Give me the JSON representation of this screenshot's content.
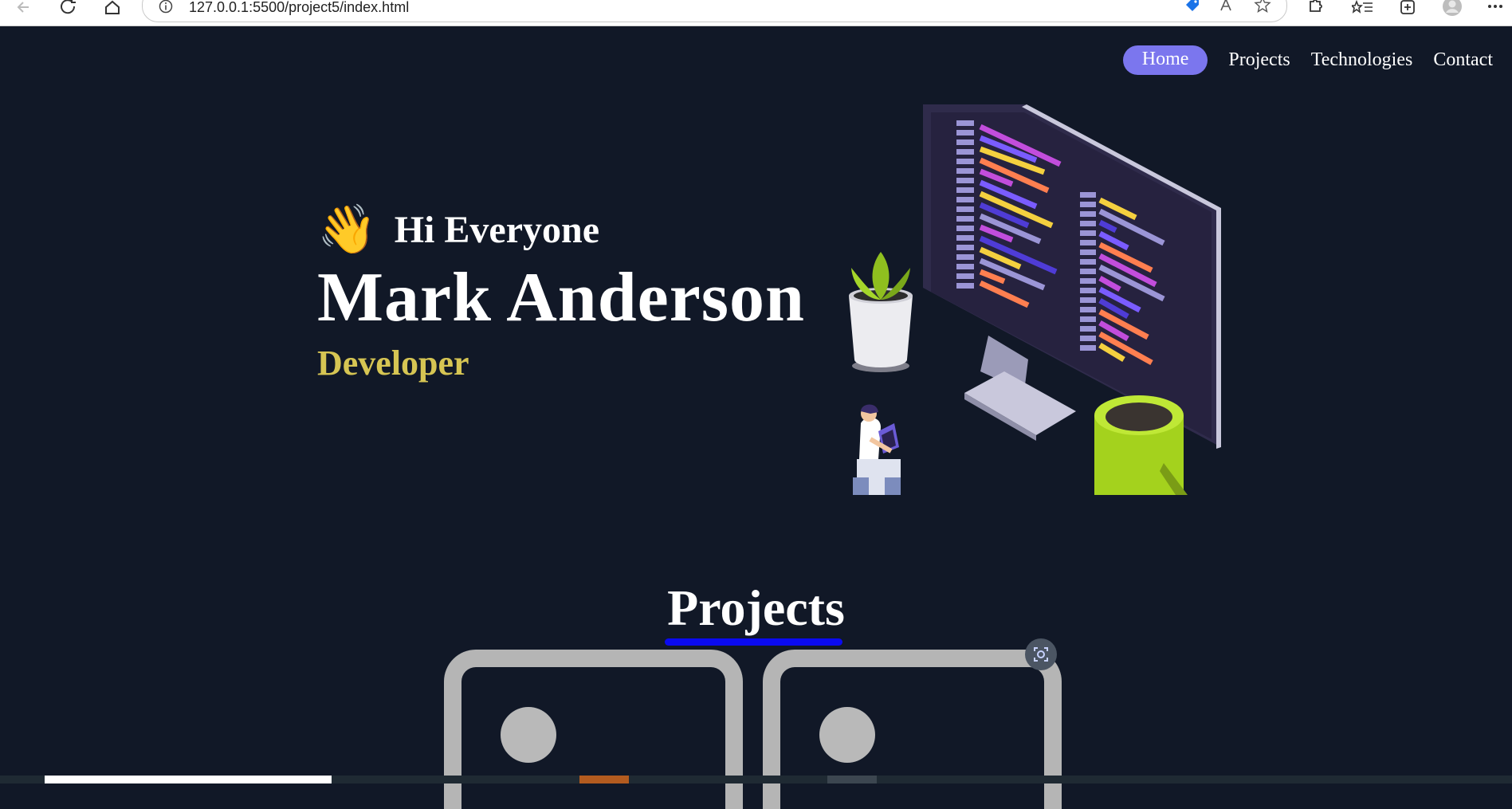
{
  "browser": {
    "url": "127.0.0.1:5500/project5/index.html",
    "icons": [
      "back-icon",
      "refresh-icon",
      "home-icon",
      "info-icon",
      "tag-icon",
      "read-aloud-icon",
      "favorite-add-icon",
      "extensions-icon",
      "favorites-icon",
      "collections-icon",
      "profile-icon",
      "more-icon"
    ]
  },
  "nav": {
    "items": [
      {
        "label": "Home",
        "active": true
      },
      {
        "label": "Projects"
      },
      {
        "label": "Technologies"
      },
      {
        "label": "Contact"
      }
    ]
  },
  "hero": {
    "greeting_emoji": "👋",
    "greeting": "Hi Everyone",
    "name": "Mark Anderson",
    "role": "Developer"
  },
  "projects": {
    "title": "Projects"
  },
  "colors": {
    "background": "#111827",
    "accent": "#7b76ee",
    "role": "#d6c553",
    "underline": "#0a0af0",
    "card_border": "#b5b5b5"
  }
}
